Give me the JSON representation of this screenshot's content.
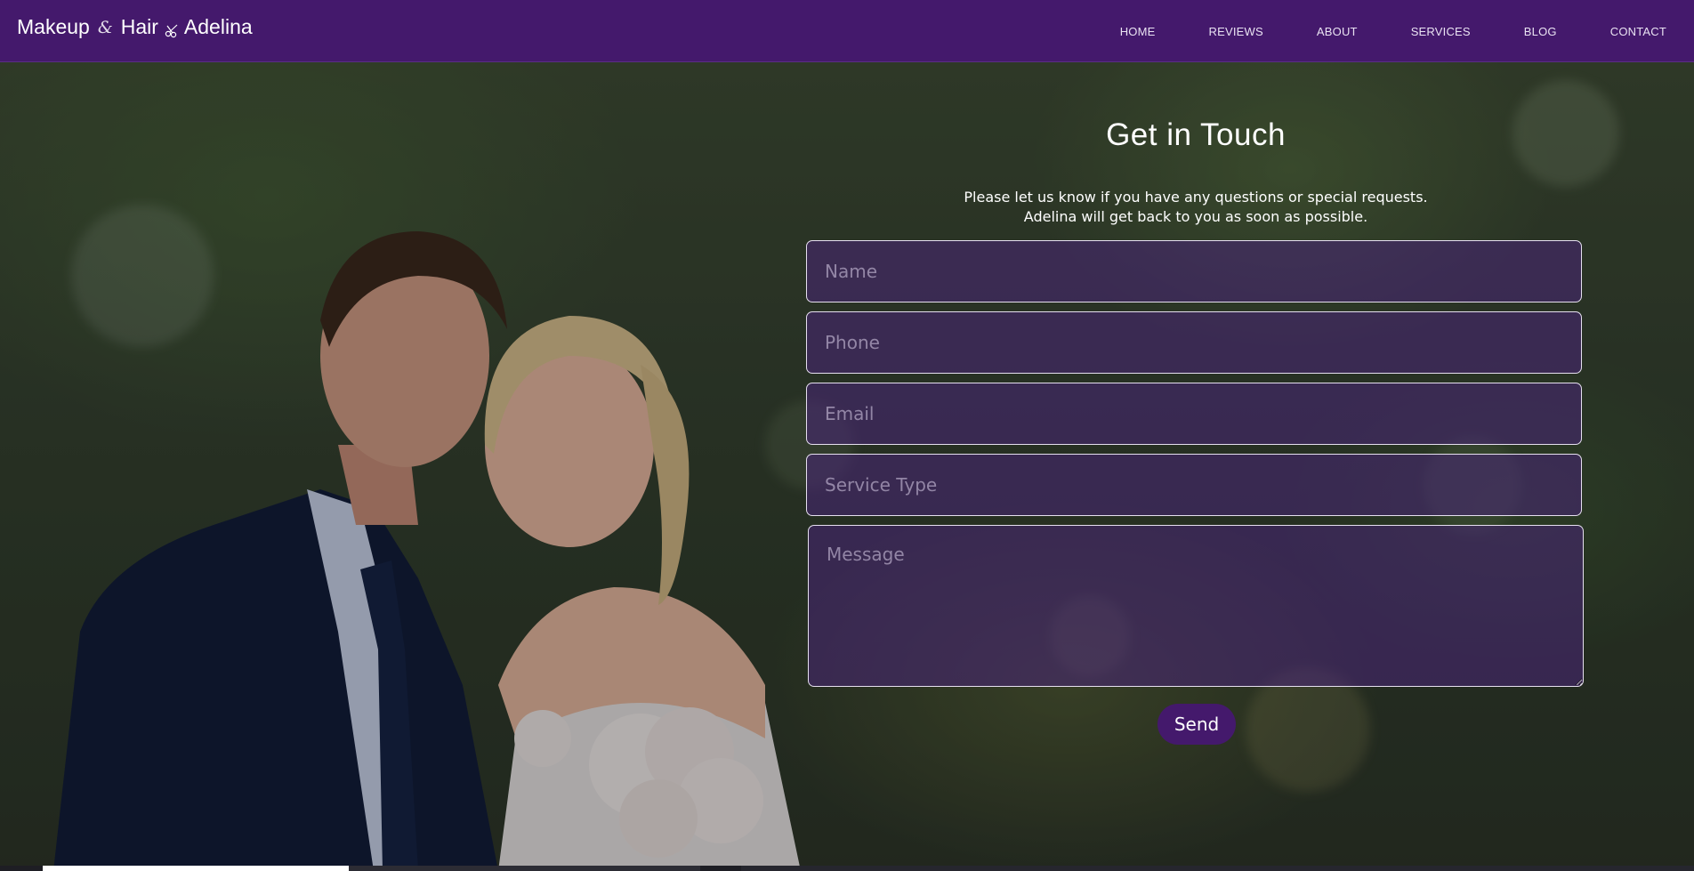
{
  "header": {
    "brand_part1": "Makeup",
    "brand_amp": "&",
    "brand_part2": "Hair",
    "brand_part3": "Adelina",
    "brand_icon": "scissors-icon",
    "nav": [
      {
        "label": "HOME"
      },
      {
        "label": "REVIEWS"
      },
      {
        "label": "ABOUT"
      },
      {
        "label": "SERVICES"
      },
      {
        "label": "BLOG"
      },
      {
        "label": "CONTACT"
      }
    ]
  },
  "contact": {
    "title": "Get in Touch",
    "intro_line1": "Please let us know if you have any questions or special requests.",
    "intro_line2": "Adelina will get back to you as soon as possible.",
    "fields": {
      "name_placeholder": "Name",
      "phone_placeholder": "Phone",
      "email_placeholder": "Email",
      "service_placeholder": "Service Type",
      "message_placeholder": "Message"
    },
    "send_label": "Send"
  },
  "colors": {
    "brand_purple": "#44196c",
    "field_border": "#e6dff0",
    "text": "#ffffff"
  }
}
